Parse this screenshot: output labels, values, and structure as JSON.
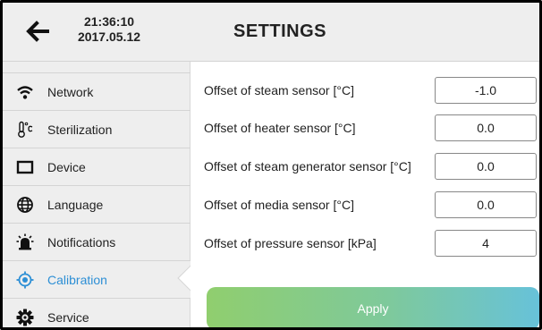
{
  "header": {
    "time": "21:36:10",
    "date": "2017.05.12",
    "title": "SETTINGS",
    "back_icon": "arrow-left-icon"
  },
  "sidebar": {
    "items": [
      {
        "label": "Network",
        "icon": "wifi-icon"
      },
      {
        "label": "Sterilization",
        "icon": "thermometer-icon"
      },
      {
        "label": "Device",
        "icon": "device-icon"
      },
      {
        "label": "Language",
        "icon": "globe-icon"
      },
      {
        "label": "Notifications",
        "icon": "alarm-icon"
      },
      {
        "label": "Calibration",
        "icon": "crosshair-icon",
        "active": true
      },
      {
        "label": "Service",
        "icon": "gear-icon"
      }
    ]
  },
  "calibration": {
    "rows": [
      {
        "label": "Offset of steam sensor [°C]",
        "value": "-1.0"
      },
      {
        "label": "Offset of heater sensor [°C]",
        "value": "0.0"
      },
      {
        "label": "Offset of steam generator sensor [°C]",
        "value": "0.0"
      },
      {
        "label": "Offset of media sensor [°C]",
        "value": "0.0"
      },
      {
        "label": "Offset of pressure sensor [kPa]",
        "value": "4"
      }
    ],
    "apply_label": "Apply"
  },
  "colors": {
    "accent": "#2d8fd5",
    "apply_start": "#90ce6e",
    "apply_end": "#67c2d9"
  }
}
